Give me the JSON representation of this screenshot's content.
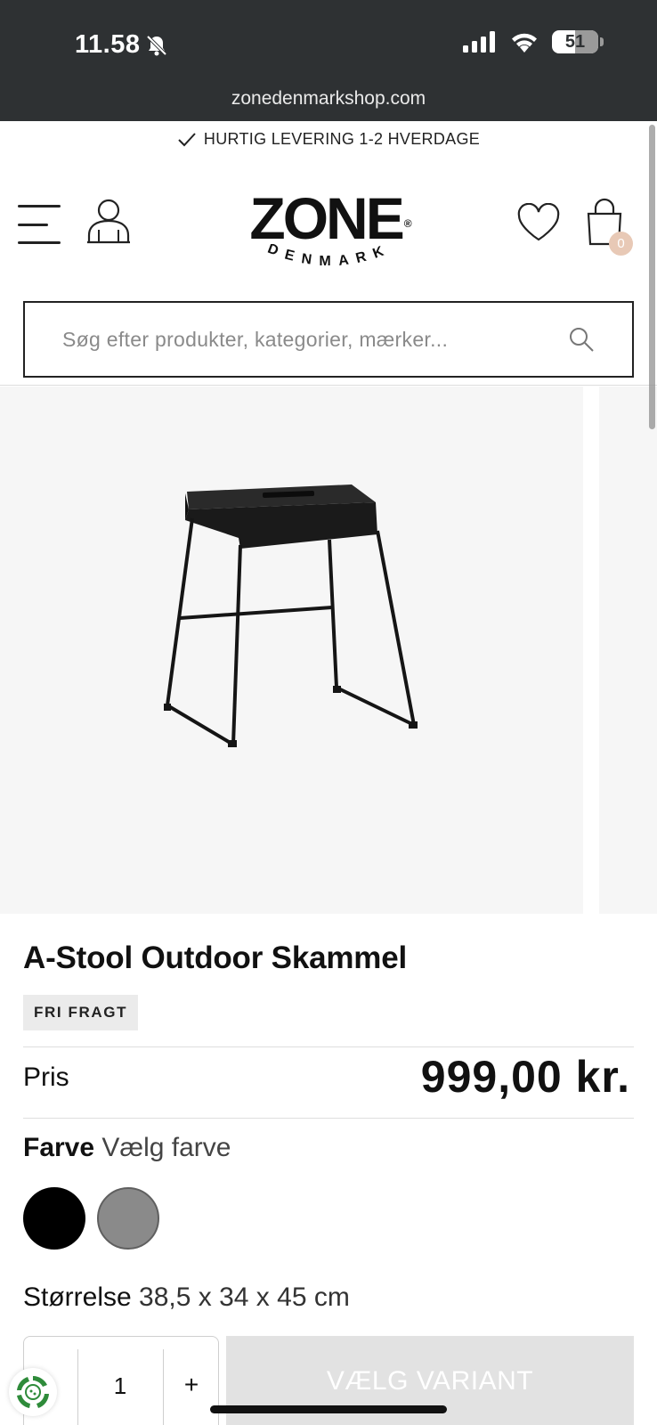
{
  "status_bar": {
    "time": "11.58",
    "battery": "51",
    "url": "zonedenmarkshop.com"
  },
  "delivery_banner": "HURTIG LEVERING 1-2 HVERDAGE",
  "header": {
    "logo_main": "ZONE",
    "logo_sub": "DENMARK",
    "logo_reg": "®",
    "cart_count": "0"
  },
  "search": {
    "placeholder": "Søg efter produkter, kategorier, mærker..."
  },
  "product": {
    "title": "A-Stool Outdoor Skammel",
    "badge": "FRI FRAGT",
    "price_label": "Pris",
    "price": "999,00 kr.",
    "color_label": "Farve",
    "color_prompt": "Vælg farve",
    "colors": [
      "#000000",
      "#8a8a8a"
    ],
    "size_label": "Størrelse",
    "size_value": "38,5 x 34 x 45 cm"
  },
  "actions": {
    "quantity": "1",
    "plus": "+",
    "cta": "VÆLG VARIANT"
  }
}
